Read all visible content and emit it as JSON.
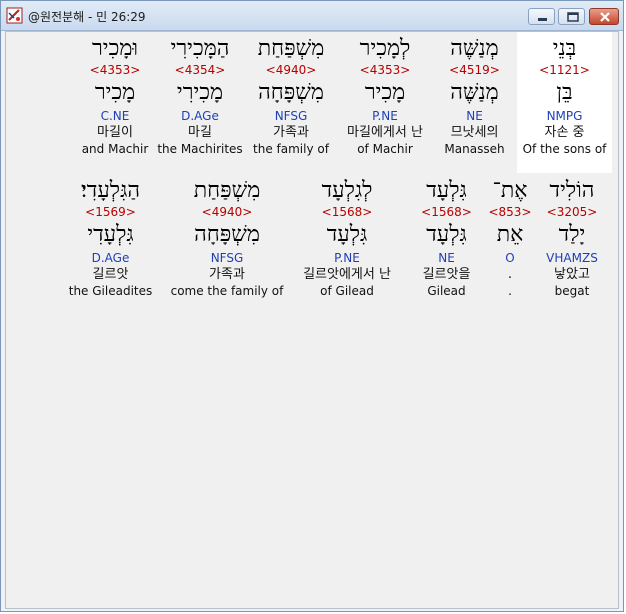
{
  "window": {
    "title": "@원전분해 - 민 26:29"
  },
  "rows": [
    {
      "words": [
        {
          "hebrew": "בְּנֵי",
          "strong": "<1121>",
          "lemma": "בֵּן",
          "parse": "NMPG",
          "korean": "자손 중",
          "english": "Of the sons of",
          "highlighted": true
        },
        {
          "hebrew": "מְנַשֶּׁה",
          "strong": "<4519>",
          "lemma": "מְנַשֶּׁה",
          "parse": "NE",
          "korean": "므낫세의",
          "english": "Manasseh",
          "highlighted": false
        },
        {
          "hebrew": "לְמָכִיר",
          "strong": "<4353>",
          "lemma": "מָכִיר",
          "parse": "P.NE",
          "korean": "마길에게서 난",
          "english": "of Machir",
          "highlighted": false
        },
        {
          "hebrew": "מִשְׁפַּחַת",
          "strong": "<4940>",
          "lemma": "מִשְׁפָּחָה",
          "parse": "NFSG",
          "korean": "가족과",
          "english": "the family of",
          "highlighted": false
        },
        {
          "hebrew": "הַמָּכִירִי",
          "strong": "<4354>",
          "lemma": "מָכִירִי",
          "parse": "D.AGe",
          "korean": "마길",
          "english": "the Machirites",
          "highlighted": false
        },
        {
          "hebrew": "וּמָכִיר",
          "strong": "<4353>",
          "lemma": "מָכִיר",
          "parse": "C.NE",
          "korean": "마길이",
          "english": "and Machir",
          "highlighted": false
        }
      ]
    },
    {
      "words": [
        {
          "hebrew": "הוֹלִיד",
          "strong": "<3205>",
          "lemma": "יָלַד",
          "parse": "VHAMZS",
          "korean": "낳았고",
          "english": "begat",
          "highlighted": false
        },
        {
          "hebrew": "אֶת־",
          "strong": "<853>",
          "lemma": "אֵת",
          "parse": "O",
          "korean": ".",
          "english": ".",
          "highlighted": false
        },
        {
          "hebrew": "גִּלְעָד",
          "strong": "<1568>",
          "lemma": "גִּלְעָד",
          "parse": "NE",
          "korean": "길르앗을",
          "english": "Gilead",
          "highlighted": false
        },
        {
          "hebrew": "לְגִלְעָד",
          "strong": "<1568>",
          "lemma": "גִּלְעָד",
          "parse": "P.NE",
          "korean": "길르앗에게서 난",
          "english": "of Gilead",
          "highlighted": false
        },
        {
          "hebrew": "מִשְׁפַּחַת",
          "strong": "<4940>",
          "lemma": "מִשְׁפָּחָה",
          "parse": "NFSG",
          "korean": "가족과",
          "english": "come the family of",
          "highlighted": false
        },
        {
          "hebrew": "הַגִּלְעָדִי׃",
          "strong": "<1569>",
          "lemma": "גִּלְעָדִי",
          "parse": "D.AGe",
          "korean": "길르앗",
          "english": "the Gileadites",
          "highlighted": false
        }
      ]
    }
  ],
  "colors": {
    "strong": "#b80000",
    "parse": "#1f3fb8",
    "highlight": "#ffffff",
    "background": "#f0f0f0"
  }
}
